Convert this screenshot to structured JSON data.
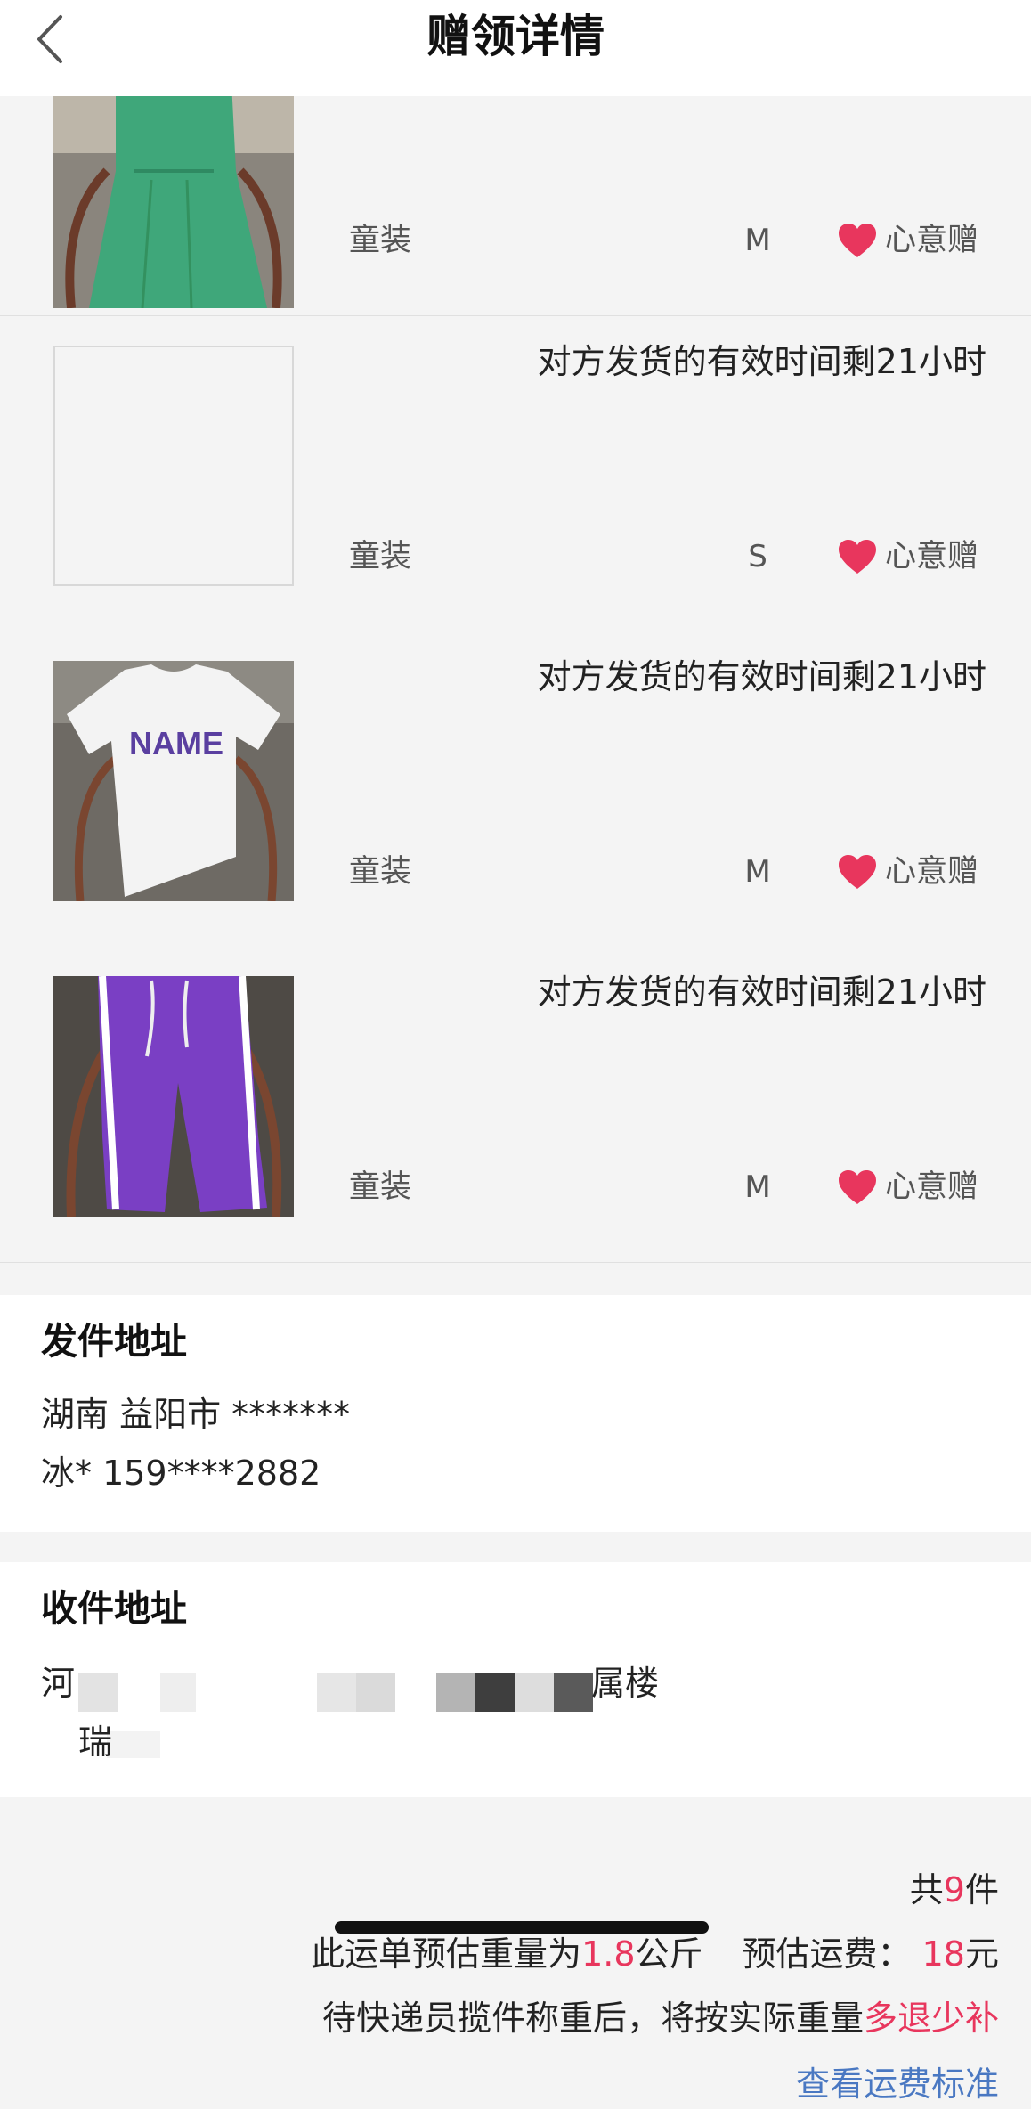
{
  "header": {
    "title": "赠领详情",
    "back_icon": "chevron-left-icon"
  },
  "items": [
    {
      "countdown": "",
      "category": "童装",
      "size": "M",
      "gift_label": "心意赠",
      "image": "green-dress"
    },
    {
      "countdown": "对方发货的有效时间剩21小时",
      "category": "童装",
      "size": "S",
      "gift_label": "心意赠",
      "image": "empty"
    },
    {
      "countdown": "对方发货的有效时间剩21小时",
      "category": "童装",
      "size": "M",
      "gift_label": "心意赠",
      "image": "white-tshirt",
      "image_text": "NAME"
    },
    {
      "countdown": "对方发货的有效时间剩21小时",
      "category": "童装",
      "size": "M",
      "gift_label": "心意赠",
      "image": "purple-pants"
    }
  ],
  "sender": {
    "title": "发件地址",
    "address": "湖南 益阳市 *******",
    "contact": "冰* 159****2882"
  },
  "receiver": {
    "title": "收件地址",
    "address_start": "河",
    "address_end": "属楼",
    "contact_start": "瑞"
  },
  "summary": {
    "count_prefix": "共",
    "count": "9",
    "count_suffix": "件",
    "weight_prefix": "此运单预估重量为",
    "weight": "1.8",
    "weight_unit": "公斤",
    "fee_label": "预估运费：",
    "fee": "18",
    "fee_unit": "元",
    "note_prefix": "待快递员揽件称重后，将按实际重量",
    "note_highlight": "多退少补",
    "link": "查看运费标准"
  },
  "colors": {
    "accent": "#e8365d",
    "link": "#4a78c2",
    "heart": "#e8365d"
  }
}
